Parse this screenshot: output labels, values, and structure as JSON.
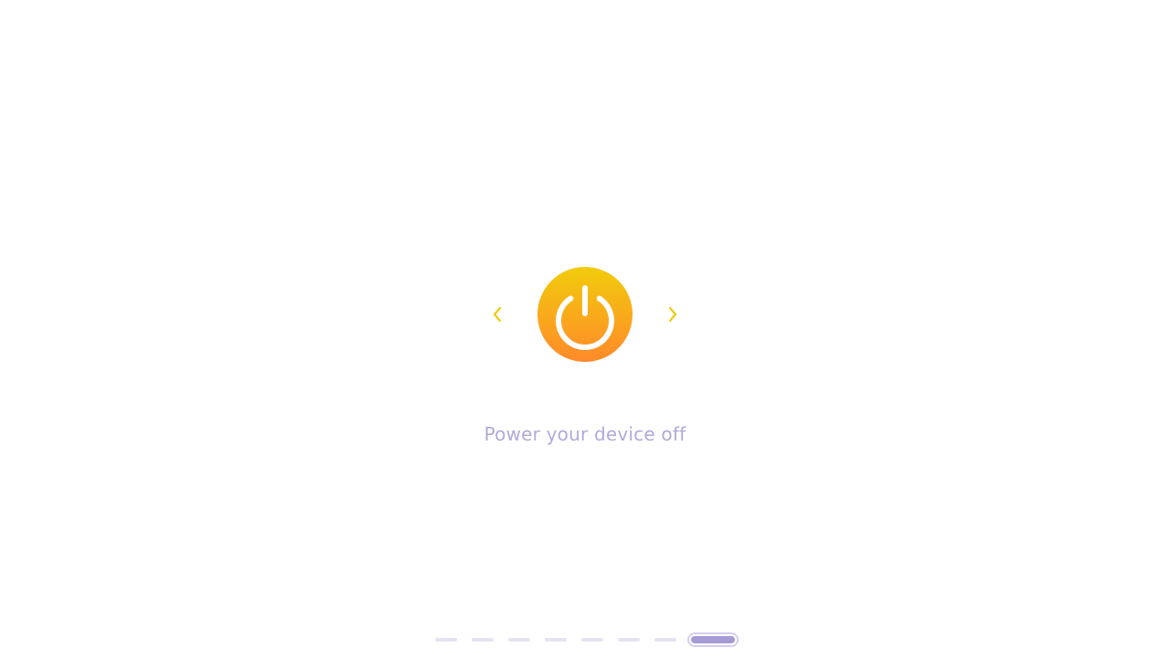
{
  "slide": {
    "caption": "Power your device off",
    "icon": "power-icon"
  },
  "navigation": {
    "prev_icon": "chevron-left-icon",
    "next_icon": "chevron-right-icon"
  },
  "pager": {
    "total": 8,
    "current": 8
  },
  "colors": {
    "accent": "#F2C811",
    "gradient_top": "#F2CC0C",
    "gradient_bottom": "#FF8A2A",
    "caption_text": "#B3A9D9",
    "pager_inactive": "#E6E2F2",
    "pager_active_fill": "#A79BD6",
    "pager_active_ring": "#D5CFEE"
  }
}
